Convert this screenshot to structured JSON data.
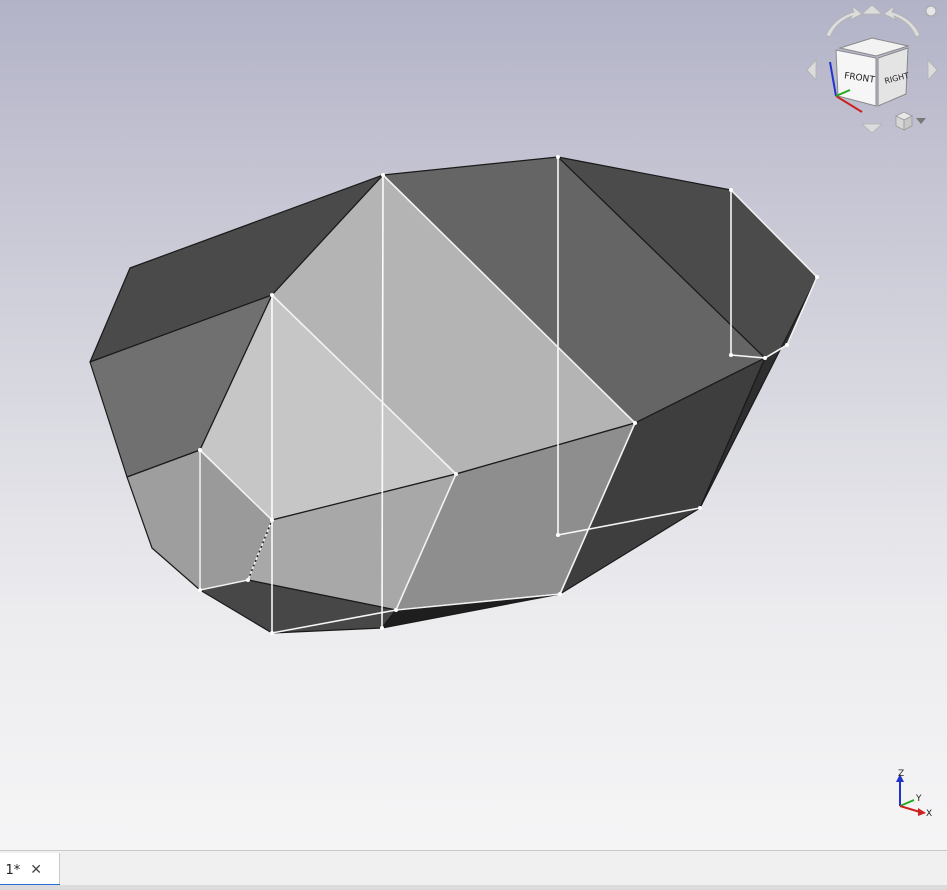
{
  "view": {
    "background_top": "#b3b3c8",
    "background_bottom": "#f5f5f6"
  },
  "navcube": {
    "faces": {
      "front": "FRONT",
      "right": "RIGHT"
    },
    "icons": [
      "rotate-left-icon",
      "rotate-right-icon",
      "arrow-up-icon",
      "arrow-down-icon",
      "arrow-left-icon",
      "arrow-right-icon",
      "view-menu-icon",
      "close-icon"
    ]
  },
  "axes": {
    "z_label": "Z",
    "y_label": "Y",
    "x_label": "X",
    "colors": {
      "x": "#cc2222",
      "y": "#22aa22",
      "z": "#2233cc"
    }
  },
  "tabs": [
    {
      "label": ": 1*",
      "active": true,
      "close_icon": "close-icon"
    }
  ]
}
